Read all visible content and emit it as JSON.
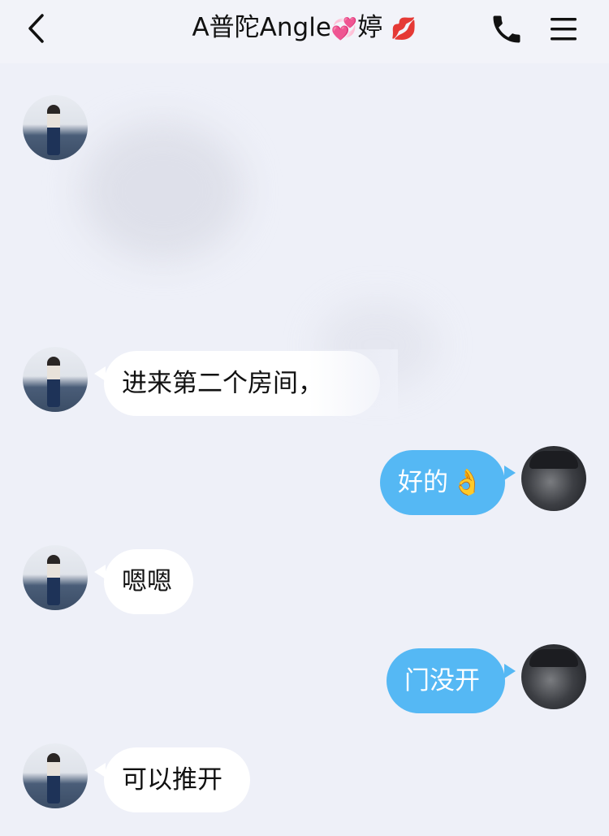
{
  "header": {
    "title": "A普陀Angle",
    "title_emoji": "💞",
    "title_suffix": "婷",
    "title_lips": "💋"
  },
  "icons": {
    "back": "chevron-left-icon",
    "call": "phone-icon",
    "menu": "hamburger-menu-icon"
  },
  "colors": {
    "background": "#eef0f8",
    "incoming_bubble": "#ffffff",
    "outgoing_bubble": "#55b8f4"
  },
  "messages": [
    {
      "side": "incoming",
      "text": "进来第二个房间，"
    },
    {
      "side": "outgoing",
      "text": "好的",
      "emoji": "👌"
    },
    {
      "side": "incoming",
      "text": "嗯嗯"
    },
    {
      "side": "outgoing",
      "text": "门没开"
    },
    {
      "side": "incoming",
      "text": "可以推开"
    }
  ]
}
